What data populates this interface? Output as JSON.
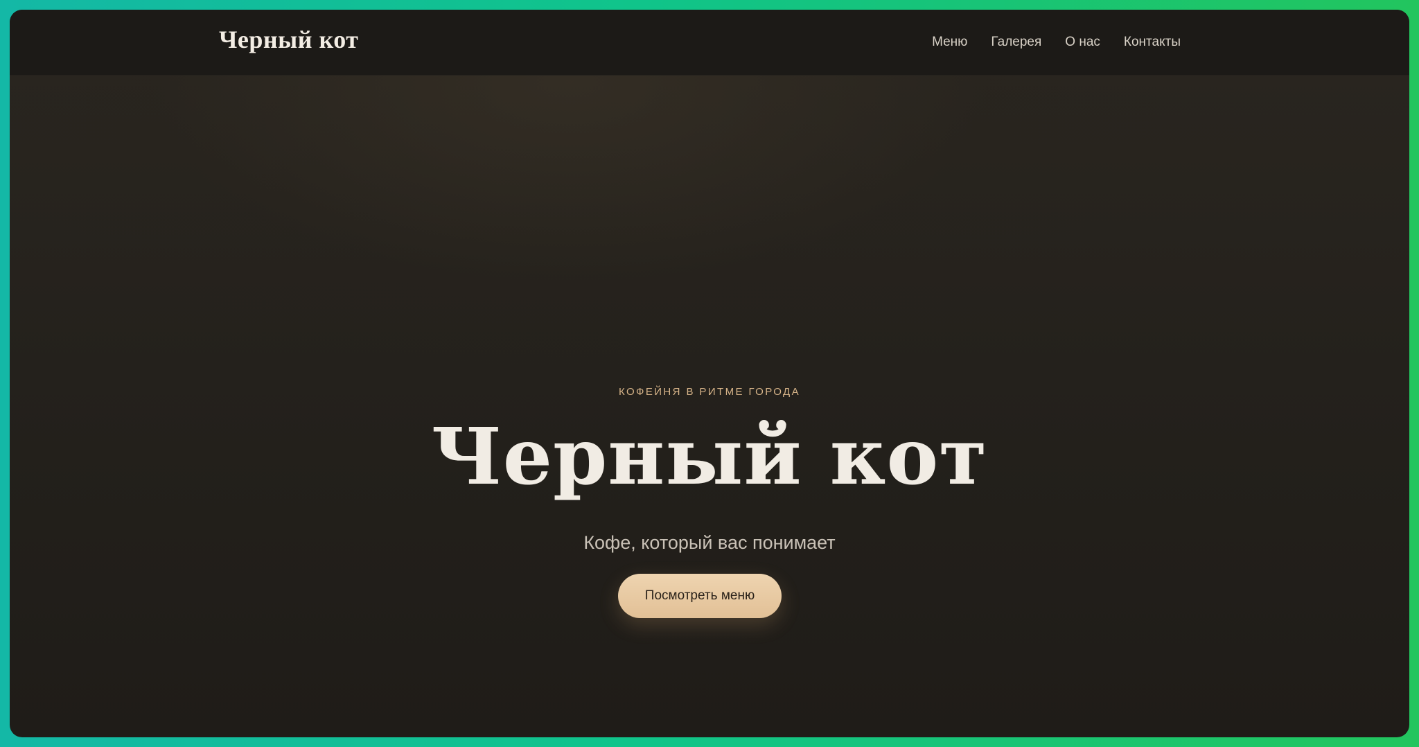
{
  "navbar": {
    "logo": "Черный кот",
    "links": [
      {
        "label": "Меню"
      },
      {
        "label": "Галерея"
      },
      {
        "label": "О нас"
      },
      {
        "label": "Контакты"
      }
    ]
  },
  "hero": {
    "eyebrow": "КОФЕЙНЯ В РИТМЕ ГОРОДА",
    "title": "Черный кот",
    "subtitle": "Кофе, который вас понимает",
    "cta_label": "Посмотреть меню"
  },
  "colors": {
    "frame_gradient_start": "#14b8a6",
    "frame_gradient_end": "#22c55e",
    "background": "#24211c",
    "accent": "#e2c096",
    "title_text": "#f1ece4"
  }
}
